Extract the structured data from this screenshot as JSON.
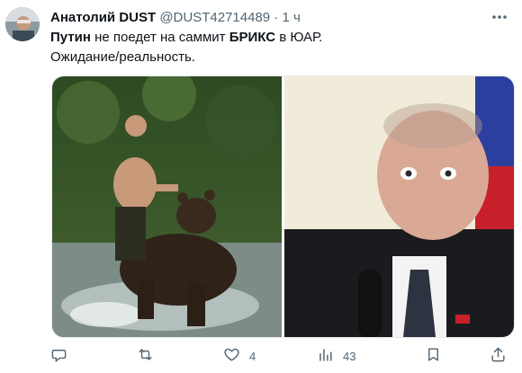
{
  "author": {
    "display_name": "Анатолий DUST",
    "handle": "@DUST42714489",
    "separator": "·",
    "time": "1 ч"
  },
  "body": {
    "bold_1": "Путин",
    "text_1": " не поедет на саммит ",
    "bold_2": "БРИКС",
    "text_2": " в ЮАР.",
    "line_2": "Ожидание/реальность."
  },
  "actions": {
    "reply_count": "",
    "retweet_count": "",
    "like_count": "4",
    "views_count": "43"
  },
  "colors": {
    "text": "#0f1419",
    "secondary": "#536471",
    "divider": "#e6e9ec"
  },
  "icons": [
    "avatar",
    "more-icon",
    "reply-icon",
    "retweet-icon",
    "like-icon",
    "views-icon",
    "bookmark-icon",
    "share-icon"
  ]
}
